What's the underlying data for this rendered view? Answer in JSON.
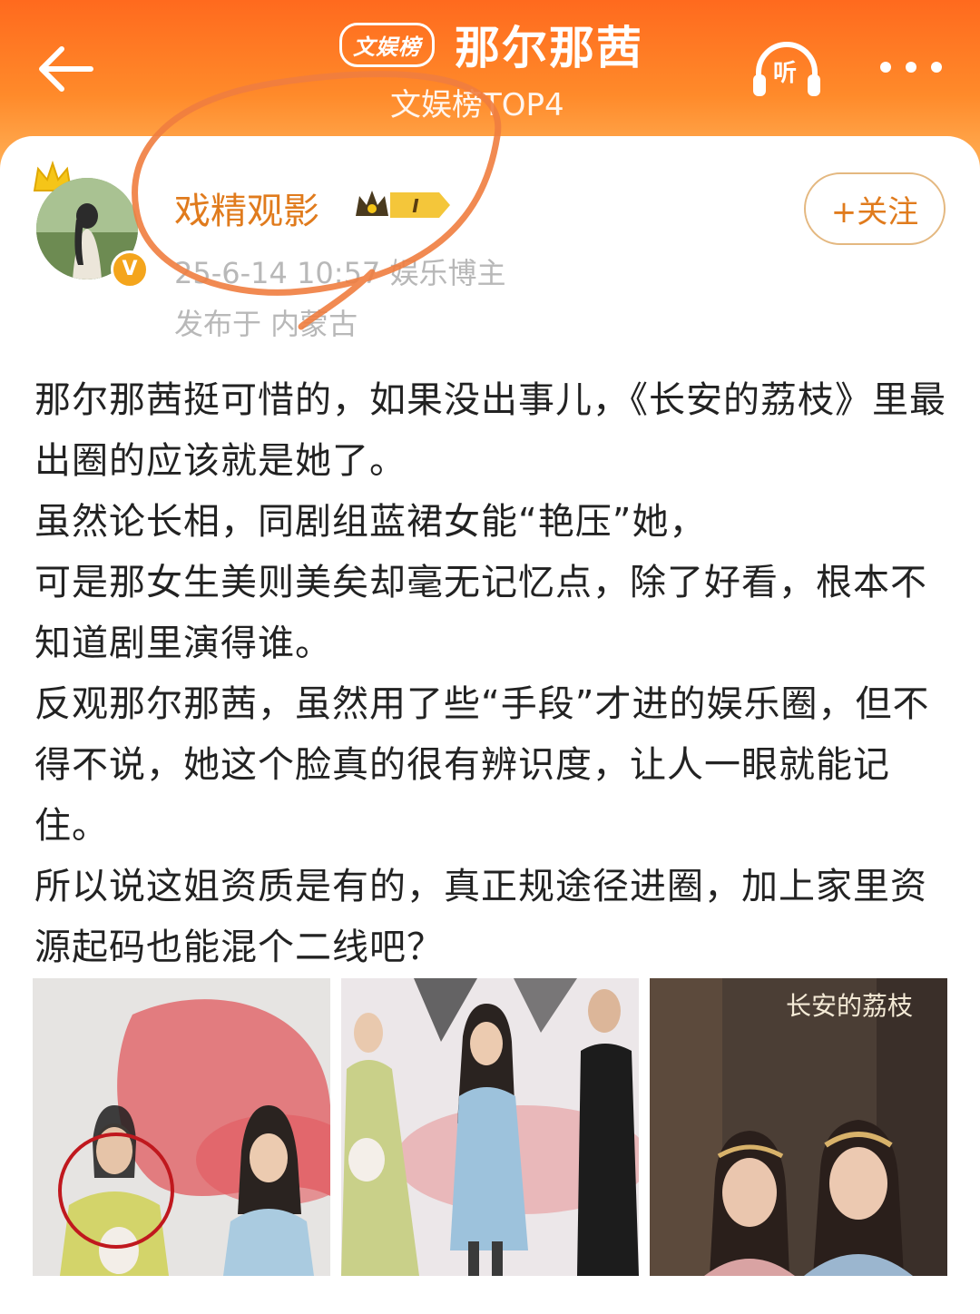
{
  "header": {
    "category_badge": "文娱榜",
    "topic_title": "那尔那茜",
    "rank_text": "文娱榜TOP4",
    "listen_label": "听"
  },
  "post": {
    "username": "戏精观影",
    "level": "I",
    "meta": "25-6-14 10:57 娱乐博主",
    "location": "发布于 内蒙古",
    "follow_label": "+关注",
    "paragraphs": [
      "那尔那茜挺可惜的，如果没出事儿，《长安的荔枝》里最出圈的应该就是她了。",
      "虽然论长相，同剧组蓝裙女能“艳压”她，",
      "可是那女生美则美矣却毫无记忆点，除了好看，根本不知道剧里演得谁。",
      "反观那尔那茜，虽然用了些“手段”才进的娱乐圈，但不得不说，她这个脸真的很有辨识度，让人一眼就能记住。",
      "所以说这姐资质是有的，真正规途径进圈，加上家里资源起码也能混个二线吧？"
    ],
    "image3_caption": "长安的荔枝"
  },
  "colors": {
    "header_orange": "#ff6a1e",
    "username_orange": "#e07b1d",
    "annotation_stroke": "#ef7d3f"
  }
}
